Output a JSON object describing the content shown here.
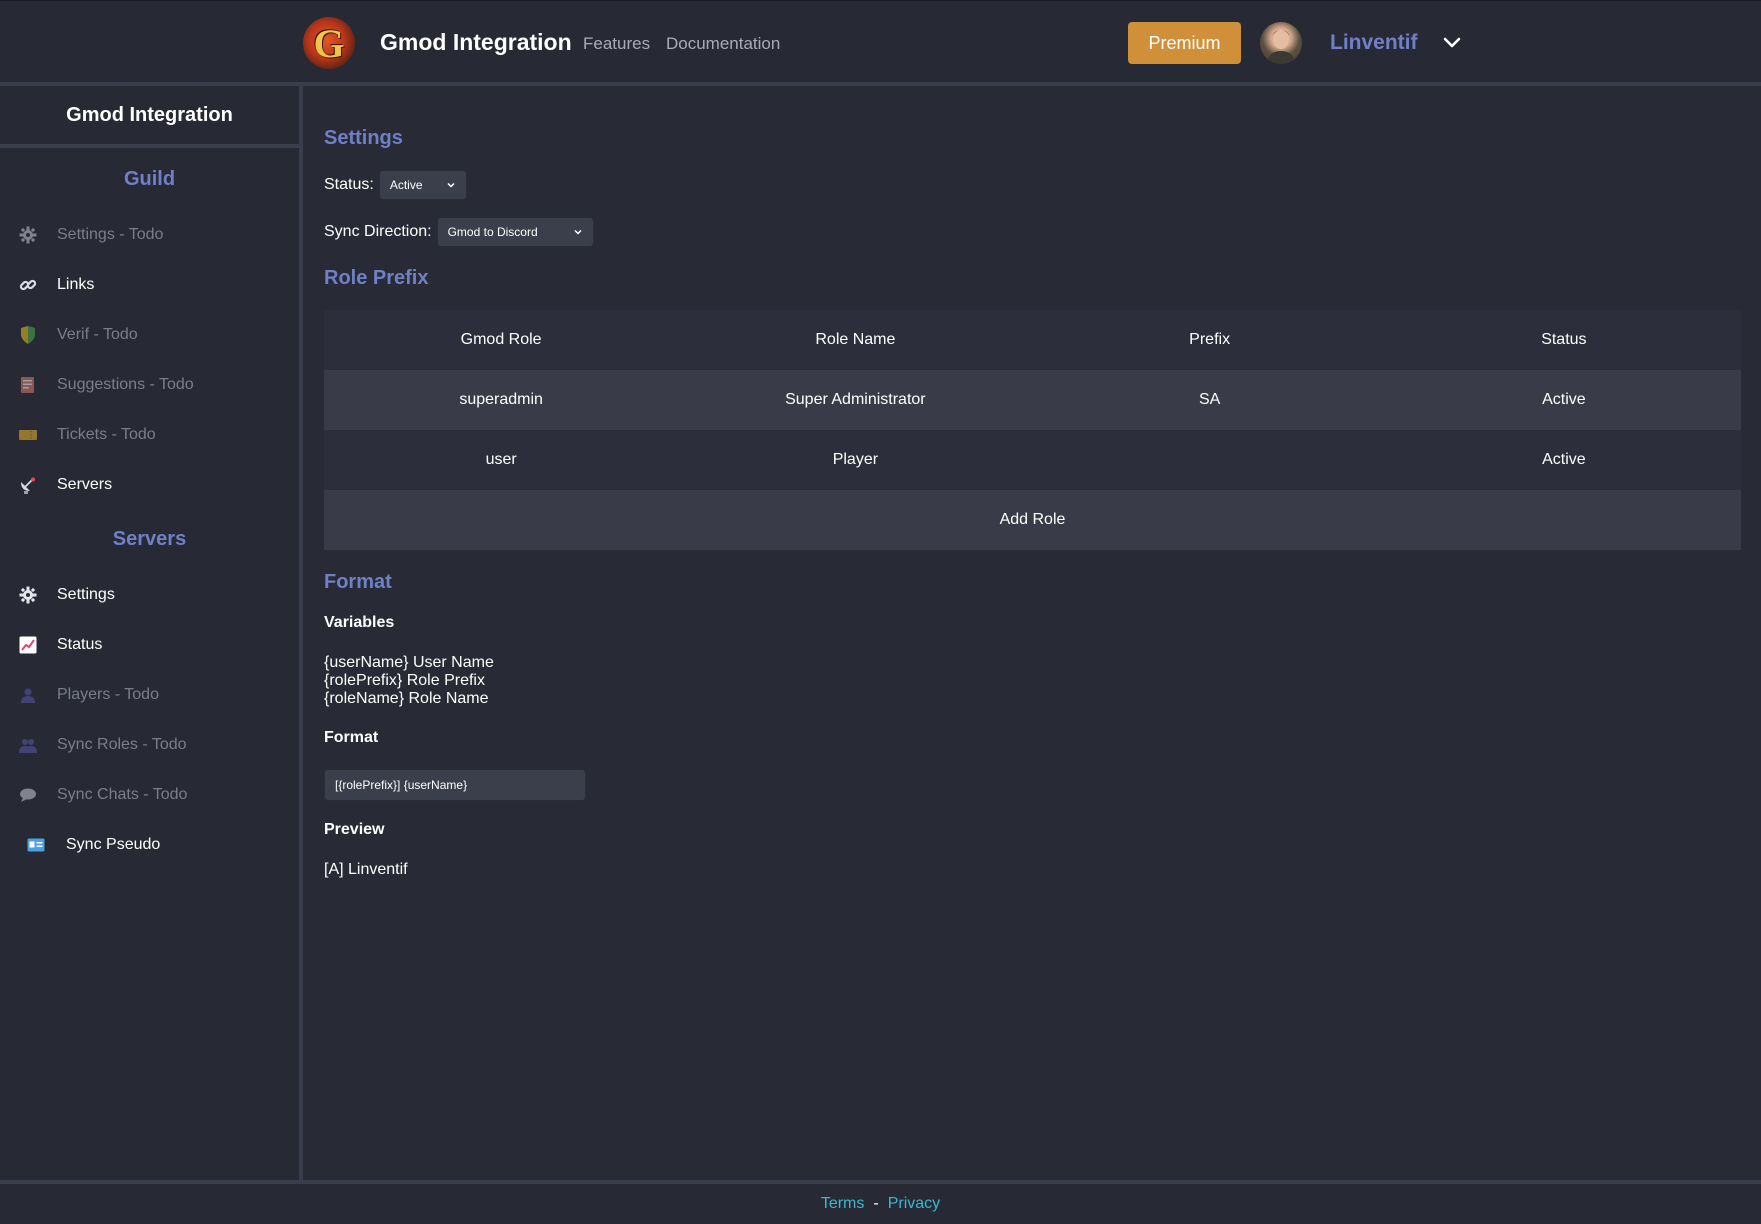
{
  "header": {
    "logo_letter": "G",
    "brand": "Gmod Integration",
    "nav": [
      {
        "label": "Features"
      },
      {
        "label": "Documentation"
      }
    ],
    "premium_label": "Premium",
    "username": "Linventif",
    "accent_color": "#6f80c6",
    "premium_color": "#d0903a"
  },
  "sidebar": {
    "title": "Gmod Integration",
    "guild_section": "Guild",
    "guild_items": [
      {
        "label": "Settings - Todo",
        "icon": "gear-icon"
      },
      {
        "label": "Links",
        "icon": "link-icon"
      },
      {
        "label": "Verif - Todo",
        "icon": "shield-icon"
      },
      {
        "label": "Suggestions - Todo",
        "icon": "document-icon"
      },
      {
        "label": "Tickets - Todo",
        "icon": "ticket-icon"
      },
      {
        "label": "Servers",
        "icon": "satellite-icon"
      }
    ],
    "servers_section": "Servers",
    "server_items": [
      {
        "label": "Settings",
        "icon": "gear-icon"
      },
      {
        "label": "Status",
        "icon": "chart-icon"
      },
      {
        "label": "Players - Todo",
        "icon": "user-icon"
      },
      {
        "label": "Sync Roles - Todo",
        "icon": "users-icon"
      },
      {
        "label": "Sync Chats - Todo",
        "icon": "chat-bubble-icon"
      },
      {
        "label": "Sync Pseudo",
        "icon": "id-card-icon"
      }
    ]
  },
  "main": {
    "settings_heading": "Settings",
    "status_label": "Status:",
    "status_value": "Active",
    "sync_label": "Sync Direction:",
    "sync_value": "Gmod to Discord",
    "role_prefix_heading": "Role Prefix",
    "table": {
      "headers": [
        "Gmod Role",
        "Role Name",
        "Prefix",
        "Status"
      ],
      "rows": [
        [
          "superadmin",
          "Super Administrator",
          "SA",
          "Active"
        ],
        [
          "user",
          "Player",
          "",
          "Active"
        ]
      ],
      "add_label": "Add Role"
    },
    "format_heading": "Format",
    "variables_heading": "Variables",
    "variables": [
      "{userName} User Name",
      "{rolePrefix} Role Prefix",
      "{roleName} Role Name"
    ],
    "format_subheading": "Format",
    "format_value": "[{rolePrefix}] {userName}",
    "preview_heading": "Preview",
    "preview_value": "[A] Linventif"
  },
  "footer": {
    "terms": "Terms",
    "separator": "-",
    "privacy": "Privacy"
  }
}
